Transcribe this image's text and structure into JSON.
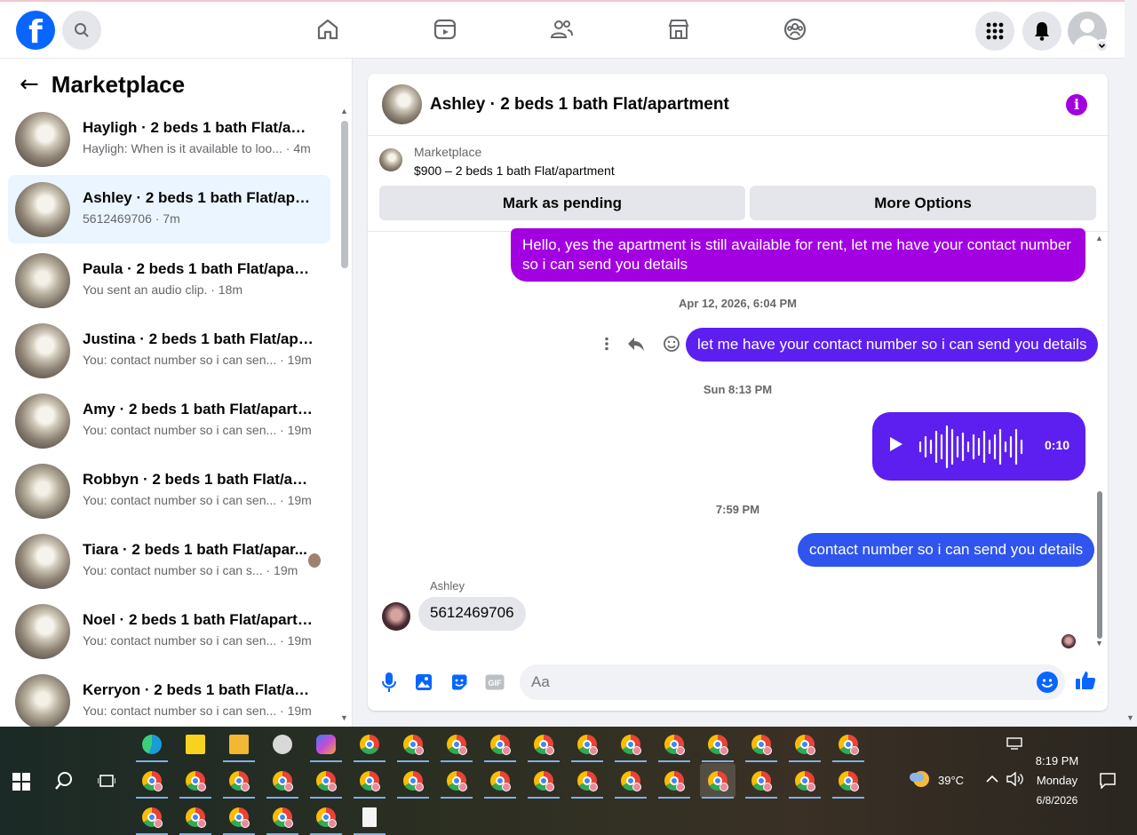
{
  "nav": {
    "logo_letter": "f",
    "icons": [
      "search-icon",
      "home-icon",
      "video-icon",
      "friends-icon",
      "marketplace-icon",
      "groups-icon",
      "menu-grid-icon",
      "notifications-icon",
      "profile-avatar"
    ]
  },
  "sidebar": {
    "title": "Marketplace",
    "conversations": [
      {
        "name": "Hayligh · 2 beds 1 bath Flat/apar...",
        "snippet": "Hayligh: When is it available to loo... · 4m"
      },
      {
        "name": "Ashley · 2 beds 1 bath Flat/apart...",
        "snippet": "5612469706 · 7m",
        "active": true
      },
      {
        "name": "Paula · 2 beds 1 bath Flat/apart...",
        "snippet": "You sent an audio clip. · 18m"
      },
      {
        "name": "Justina · 2 beds 1 bath Flat/apart...",
        "snippet": "You: contact number so i can sen... · 19m"
      },
      {
        "name": "Amy · 2 beds 1 bath Flat/apartm...",
        "snippet": "You: contact number so i can sen... · 19m"
      },
      {
        "name": "Robbyn · 2 beds 1 bath Flat/apar...",
        "snippet": "You: contact number so i can sen... · 19m"
      },
      {
        "name": "Tiara · 2 beds 1 bath Flat/apar...",
        "snippet": "You: contact number so i can s... · 19m"
      },
      {
        "name": "Noel · 2 beds 1 bath Flat/apartm...",
        "snippet": "You: contact number so i can sen... · 19m"
      },
      {
        "name": "Kerryon · 2 beds 1 bath Flat/apar...",
        "snippet": "You: contact number so i can sen... · 19m"
      }
    ]
  },
  "chat": {
    "title": "Ashley · 2 beds 1 bath Flat/apartment",
    "listing": {
      "label": "Marketplace",
      "price_title": "$900 – 2 beds 1 bath Flat/apartment",
      "mark_pending": "Mark as pending",
      "more_options": "More Options"
    },
    "messages": {
      "m1": "Hello, yes the apartment is still available for rent, let me have your contact number so i can send you details",
      "ts1": "Apr 12, 2026, 6:04 PM",
      "m2": "let me have your contact number so i can send you details",
      "ts2": "Sun 8:13 PM",
      "audio_duration": "0:10",
      "ts3": "7:59 PM",
      "m3": "contact number so i can send you details",
      "sender": "Ashley",
      "incoming": "5612469706"
    },
    "composer_placeholder": "Aa"
  },
  "taskbar": {
    "weather": "39°C",
    "time": "8:19 PM",
    "day": "Monday",
    "date": "6/8/2026"
  }
}
